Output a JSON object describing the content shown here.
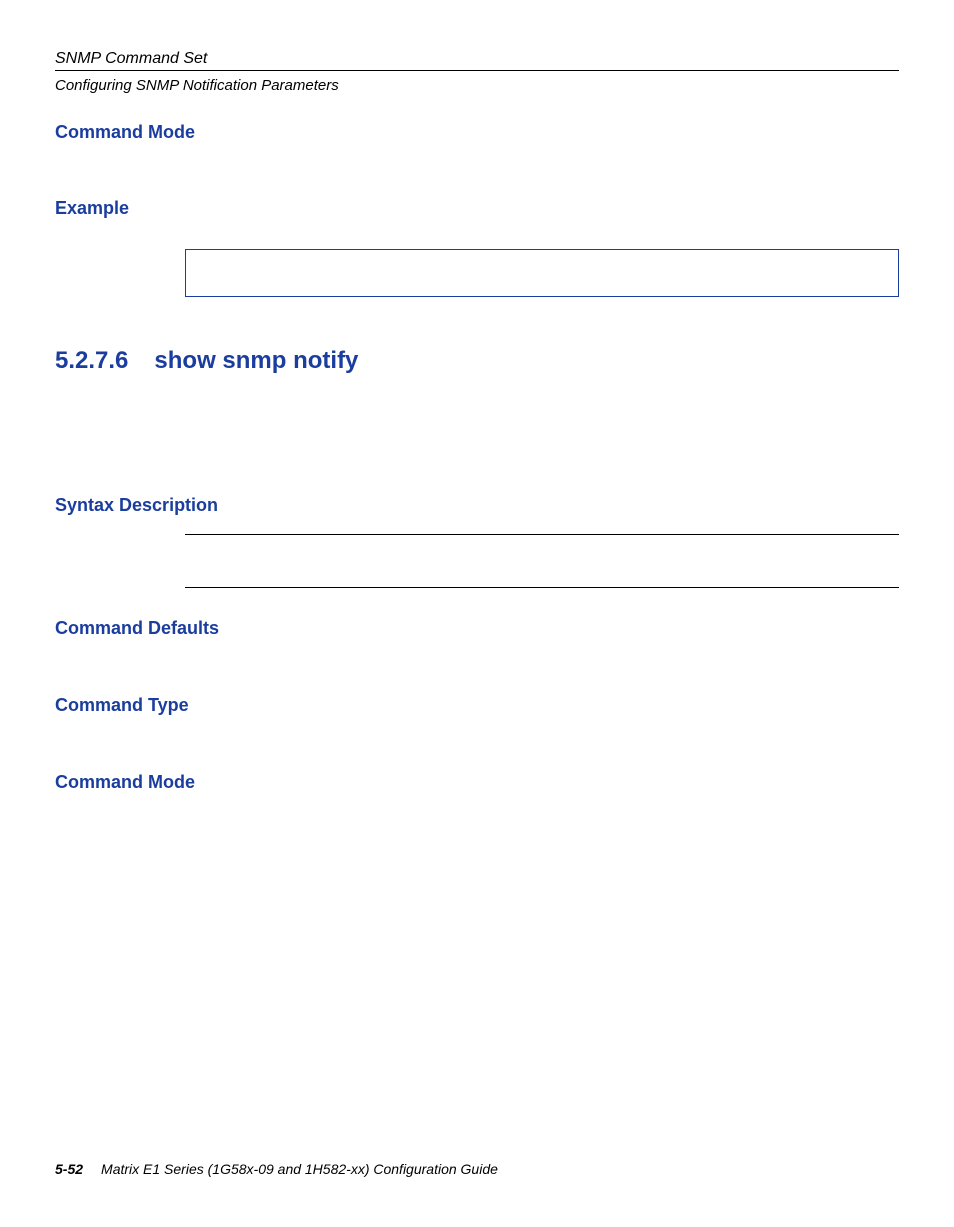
{
  "header": {
    "title": "SNMP Command Set",
    "subtitle": "Configuring SNMP Notification Parameters"
  },
  "sections": {
    "command_mode_1": "Command Mode",
    "example": "Example",
    "main_number": "5.2.7.6",
    "main_title": "show snmp notify",
    "syntax_description": "Syntax Description",
    "command_defaults": "Command Defaults",
    "command_type": "Command Type",
    "command_mode_2": "Command Mode"
  },
  "footer": {
    "page": "5-52",
    "book": "Matrix E1 Series (1G58x-09 and 1H582-xx) Configuration Guide"
  }
}
